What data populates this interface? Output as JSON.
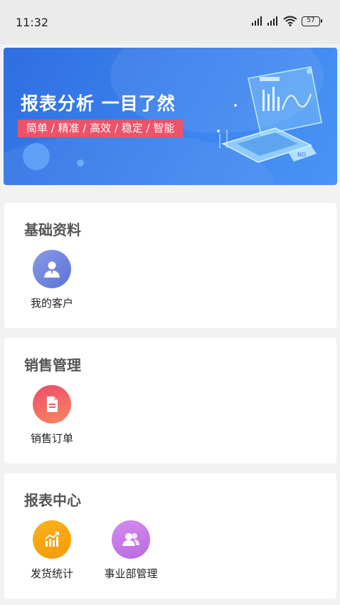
{
  "status_bar": {
    "time": "11:32",
    "battery": "57"
  },
  "banner": {
    "title": "报表分析 一目了然",
    "subtitle": "简单 / 精准 / 高效 / 稳定 / 智能"
  },
  "sections": [
    {
      "title": "基础资料",
      "items": [
        {
          "label": "我的客户",
          "icon": "customer-icon"
        }
      ]
    },
    {
      "title": "销售管理",
      "items": [
        {
          "label": "销售订单",
          "icon": "order-document-icon"
        }
      ]
    },
    {
      "title": "报表中心",
      "items": [
        {
          "label": "发货统计",
          "icon": "bar-chart-icon"
        },
        {
          "label": "事业部管理",
          "icon": "group-icon"
        }
      ]
    }
  ],
  "colors": {
    "banner_blue": "#3c83ee",
    "subtitle_red": "#ec5369",
    "customer_icon": "#6f86dc",
    "order_icon": "#f0566e",
    "stats_icon": "#f7a20c",
    "group_icon": "#c27ae8"
  }
}
